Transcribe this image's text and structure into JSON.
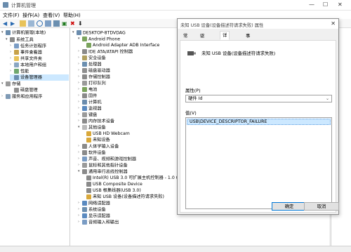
{
  "window": {
    "title": "计算机管理"
  },
  "menu": [
    "文件(F)",
    "操作(A)",
    "查看(V)",
    "帮助(H)"
  ],
  "left_tree": [
    {
      "label": "计算机管理(本地)",
      "level": 0
    },
    {
      "label": "系统工具",
      "level": 1
    },
    {
      "label": "任务计划程序",
      "level": 2
    },
    {
      "label": "事件查看器",
      "level": 2
    },
    {
      "label": "共享文件夹",
      "level": 2
    },
    {
      "label": "本地用户和组",
      "level": 2
    },
    {
      "label": "性能",
      "level": 2
    },
    {
      "label": "设备管理器",
      "level": 2,
      "selected": true
    },
    {
      "label": "存储",
      "level": 1
    },
    {
      "label": "磁盘管理",
      "level": 2
    },
    {
      "label": "服务和应用程序",
      "level": 1
    }
  ],
  "device_tree": [
    {
      "label": "DESKTOP-8TDVDAG",
      "level": 0
    },
    {
      "label": "Android Phone",
      "level": 1
    },
    {
      "label": "Android Adapter ADB Interface",
      "level": 2
    },
    {
      "label": "IDE ATA/ATAPI 控制器",
      "level": 1
    },
    {
      "label": "安全设备",
      "level": 1
    },
    {
      "label": "处理器",
      "level": 1
    },
    {
      "label": "磁盘驱动器",
      "level": 1
    },
    {
      "label": "存储控制器",
      "level": 1
    },
    {
      "label": "打印队列",
      "level": 1
    },
    {
      "label": "电池",
      "level": 1
    },
    {
      "label": "固件",
      "level": 1
    },
    {
      "label": "计算机",
      "level": 1
    },
    {
      "label": "监视器",
      "level": 1
    },
    {
      "label": "键盘",
      "level": 1
    },
    {
      "label": "内存技术设备",
      "level": 1
    },
    {
      "label": "其他设备",
      "level": 1
    },
    {
      "label": "USB HD Webcam",
      "level": 2
    },
    {
      "label": "未知设备",
      "level": 2
    },
    {
      "label": "人体学输入设备",
      "level": 1
    },
    {
      "label": "软件设备",
      "level": 1
    },
    {
      "label": "声音、视频和游戏控制器",
      "level": 1
    },
    {
      "label": "鼠标和其他指针设备",
      "level": 1
    },
    {
      "label": "通用串行总线控制器",
      "level": 1
    },
    {
      "label": "Intel(R) USB 3.0 可扩展主机控制器 - 1.0 (",
      "level": 2
    },
    {
      "label": "USB Composite Device",
      "level": 2
    },
    {
      "label": "USB 根集线器(USB 3.0)",
      "level": 2
    },
    {
      "label": "未知 USB 设备(设备描述符请求失败)",
      "level": 2
    },
    {
      "label": "网络适配器",
      "level": 1
    },
    {
      "label": "系统设备",
      "level": 1
    },
    {
      "label": "显示适配器",
      "level": 1
    },
    {
      "label": "音频输入和输出",
      "level": 1
    }
  ],
  "dialog": {
    "title": "未知 USB 设备(设备描述符请求失败) 属性",
    "tabs": [
      "常规",
      "驱动程序",
      "详细信息",
      "事件"
    ],
    "active_tab": "详细信息",
    "device_name": "未知 USB 设备(设备描述符请求失败)",
    "property_label": "属性(P)",
    "property_value": "硬件 Id",
    "value_label": "值(V)",
    "value_item": "USB\\DEVICE_DESCRIPTOR_FAILURE",
    "ok": "确定",
    "cancel": "取消"
  }
}
